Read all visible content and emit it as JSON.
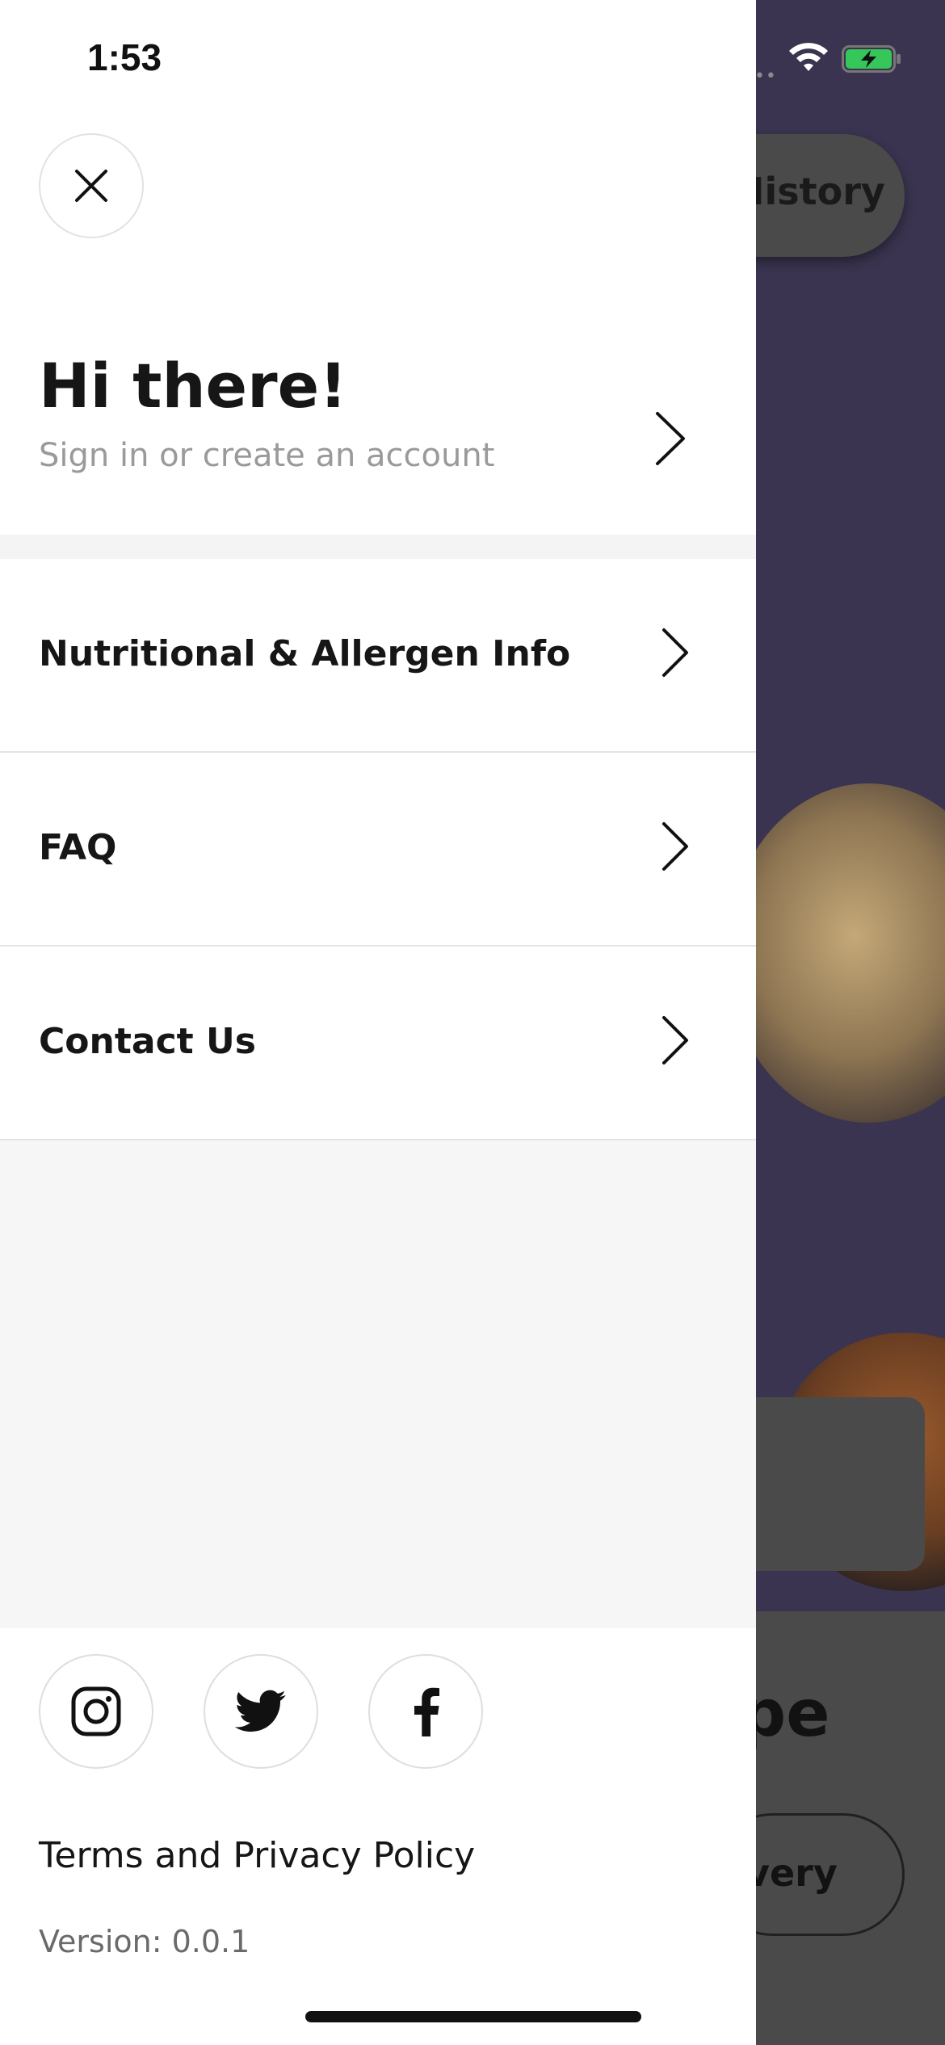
{
  "status_bar": {
    "time": "1:53",
    "icons": [
      "signal-icon",
      "wifi-icon",
      "battery-charging-icon"
    ],
    "battery_color": "#35c759"
  },
  "background": {
    "history_button_label": "History",
    "panel_title": "pe",
    "panel_button_label": "very"
  },
  "drawer": {
    "close_icon": "close-icon",
    "greeting": {
      "title": "Hi there!",
      "subtitle": "Sign in or create an account"
    },
    "menu": [
      {
        "label": "Nutritional & Allergen Info",
        "icon": "chevron-right-icon"
      },
      {
        "label": "FAQ",
        "icon": "chevron-right-icon"
      },
      {
        "label": "Contact Us",
        "icon": "chevron-right-icon"
      }
    ],
    "social": [
      {
        "name": "instagram",
        "icon": "instagram-icon"
      },
      {
        "name": "twitter",
        "icon": "twitter-icon"
      },
      {
        "name": "facebook",
        "icon": "facebook-icon"
      }
    ],
    "terms_label": "Terms and Privacy Policy",
    "version_label": "Version: 0.0.1"
  }
}
